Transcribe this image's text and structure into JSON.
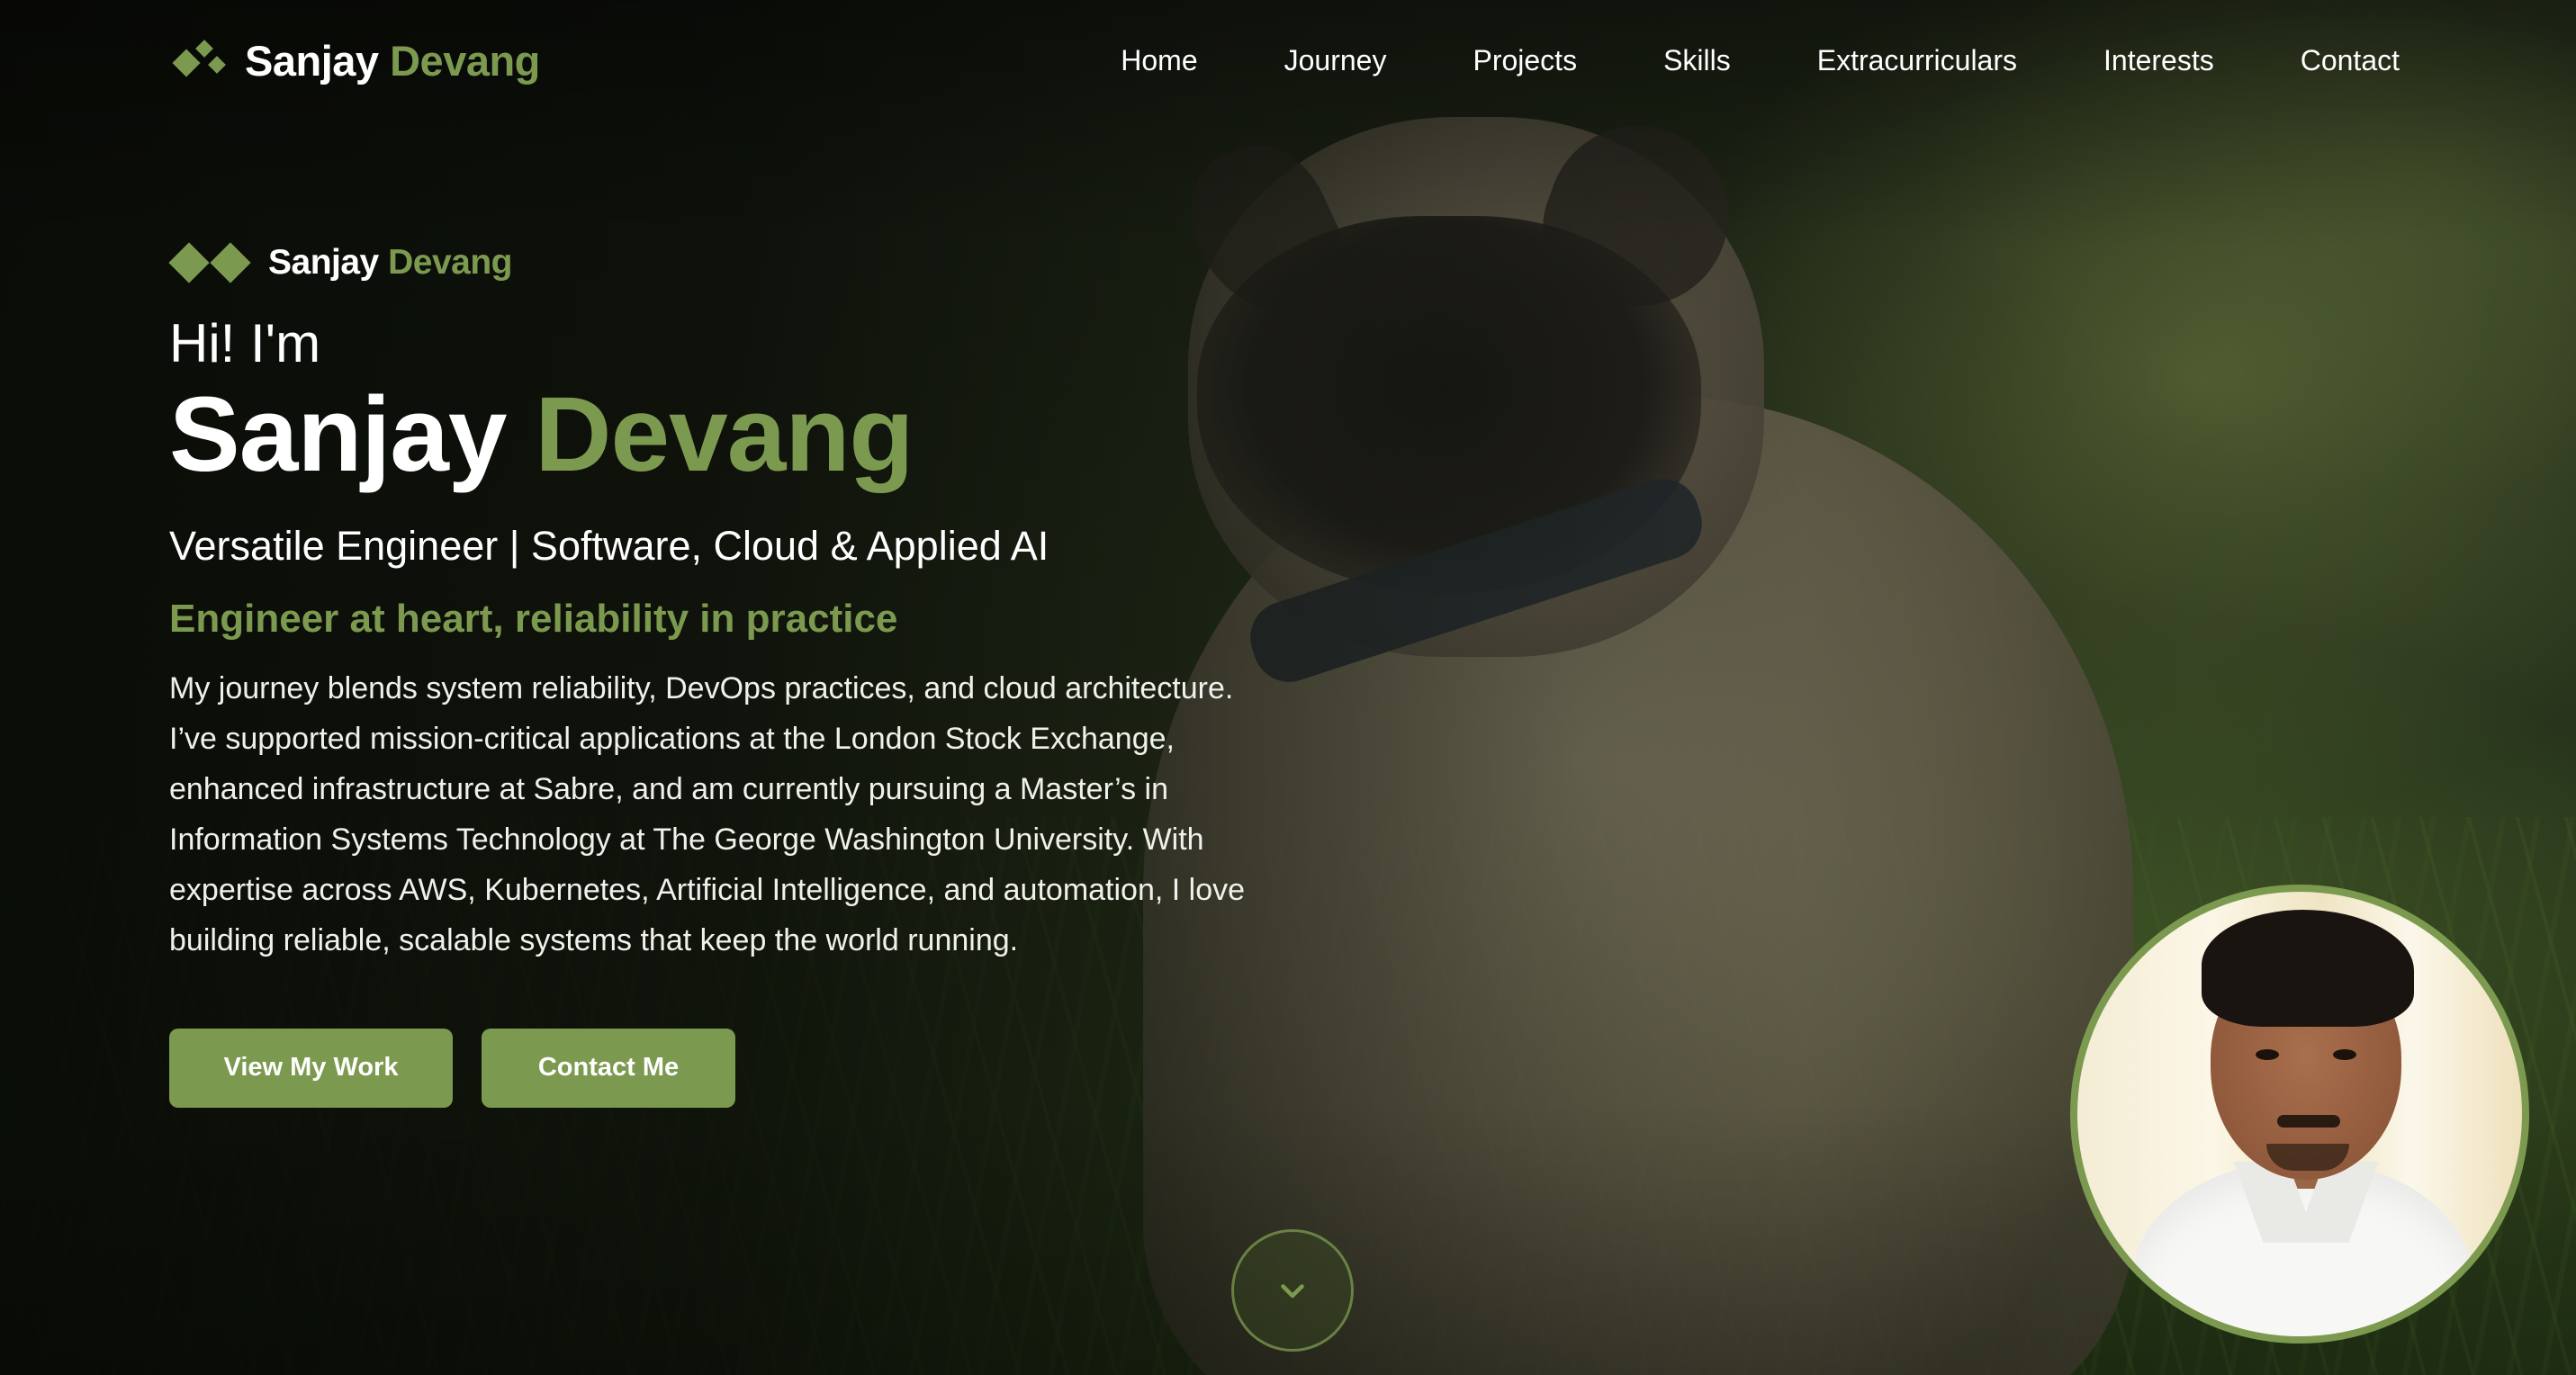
{
  "nav": {
    "brand_first": "Sanjay",
    "brand_last": "Devang",
    "links": [
      "Home",
      "Journey",
      "Projects",
      "Skills",
      "Extracurriculars",
      "Interests",
      "Contact"
    ]
  },
  "hero": {
    "mini_brand_first": "Sanjay",
    "mini_brand_last": "Devang",
    "greeting": "Hi! I'm",
    "name_first": "Sanjay",
    "name_last": "Devang",
    "role": "Versatile Engineer | Software, Cloud & Applied AI",
    "tagline": "Engineer at heart, reliability in practice",
    "bio": "My journey blends system reliability, DevOps practices, and cloud architecture. I’ve supported mission-critical applications at the London Stock Exchange, enhanced infrastructure at Sabre, and am currently pursuing a Master’s in Information Systems Technology at The George Washington University. With expertise across AWS, Kubernetes, Artificial Intelligence, and automation, I love building reliable, scalable systems that keep the world running.",
    "buttons": {
      "view_work": "View My Work",
      "contact": "Contact Me"
    }
  },
  "icons": {
    "scroll": "chevron-down-icon",
    "brand": "diamonds-logo-icon"
  },
  "colors": {
    "accent": "#7c9a4f",
    "text": "#ffffff"
  }
}
